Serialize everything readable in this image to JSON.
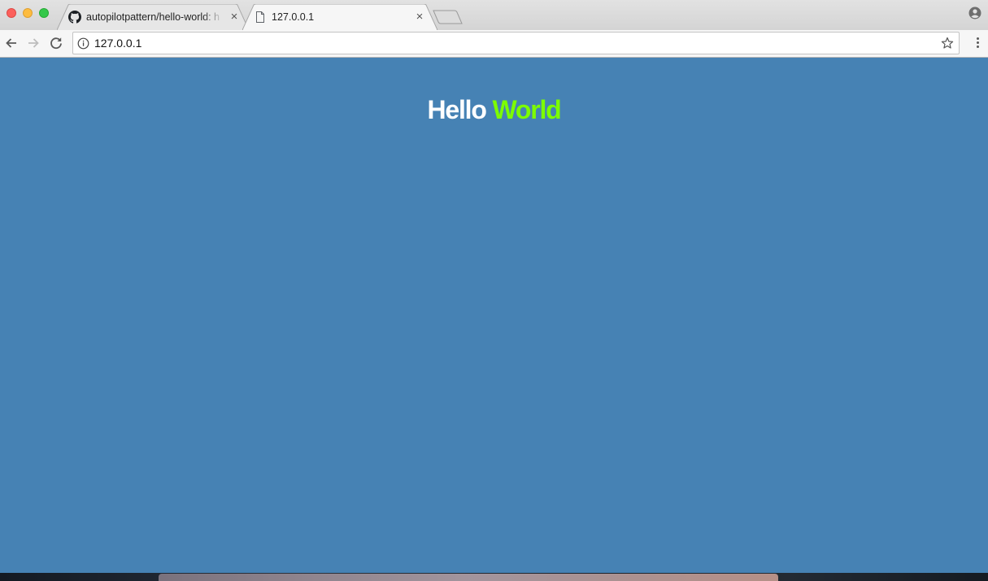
{
  "browser": {
    "tabs": [
      {
        "title": "autopilotpattern/hello-world: h",
        "favicon": "github-icon",
        "active": false
      },
      {
        "title": "127.0.0.1",
        "favicon": "document-icon",
        "active": true
      }
    ],
    "close_glyph": "×",
    "omnibox": {
      "url": "127.0.0.1",
      "security_icon": "info-icon",
      "bookmark_icon": "star-icon"
    },
    "nav_icons": [
      "back-arrow-icon",
      "forward-arrow-icon",
      "reload-icon"
    ],
    "menu_icon": "three-dots-menu-icon",
    "profile_icon": "profile-icon"
  },
  "page": {
    "heading_part1": "Hello",
    "heading_part2": "World",
    "background_color": "#4682b4",
    "part1_color": "#ffffff",
    "part2_color": "#7cfc00"
  }
}
